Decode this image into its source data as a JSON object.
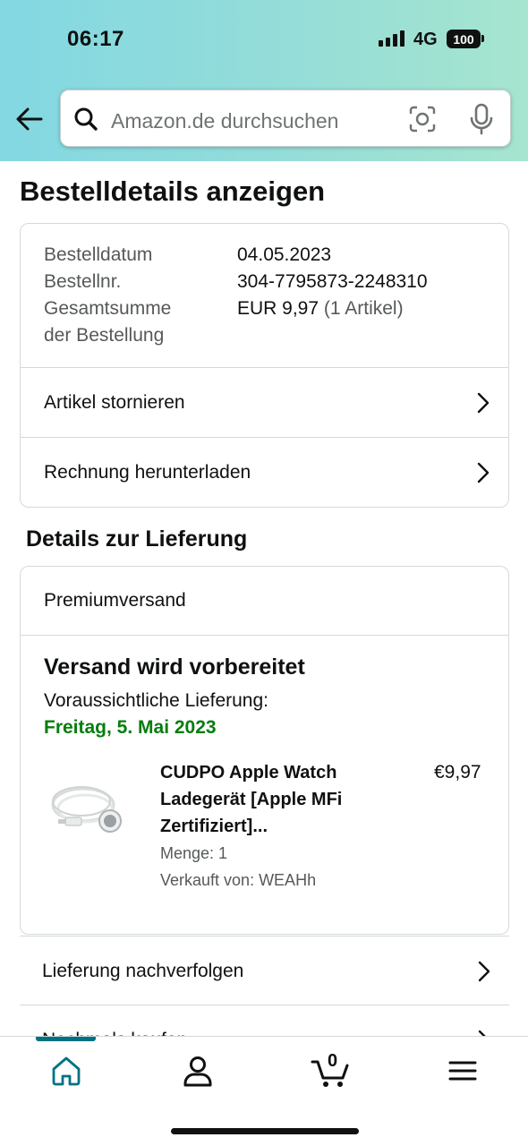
{
  "status_bar": {
    "time": "06:17",
    "network": "4G",
    "battery": "100"
  },
  "search": {
    "placeholder": "Amazon.de durchsuchen"
  },
  "page": {
    "title": "Bestelldetails anzeigen"
  },
  "order": {
    "date_label": "Bestelldatum",
    "date_value": "04.05.2023",
    "number_label": "Bestellnr.",
    "number_value": "304-7795873-2248310",
    "total_label_1": "Gesamtsumme",
    "total_label_2": "der Bestellung",
    "total_value": "EUR 9,97",
    "total_items": "(1 Artikel)",
    "cancel_label": "Artikel stornieren",
    "invoice_label": "Rechnung herunterladen"
  },
  "delivery": {
    "section_title": "Details zur Lieferung",
    "method": "Premiumversand",
    "status": "Versand wird vorbereitet",
    "eta_label": "Voraussichtliche Lieferung:",
    "eta_date": "Freitag, 5. Mai 2023",
    "product": {
      "name": "CUDPO Apple Watch Ladegerät [Apple MFi Zertifiziert]...",
      "price": "€9,97",
      "quantity": "Menge: 1",
      "seller": "Verkauft von: WEAHh"
    },
    "track_label": "Lieferung nachverfolgen",
    "buy_again_label": "Nochmals kaufen"
  },
  "tabbar": {
    "cart_count": "0",
    "active_tab": "home"
  },
  "colors": {
    "accent": "#007185",
    "eta_green": "#067d0e",
    "header_start": "#83d8e2",
    "header_end": "#a6e5cf"
  }
}
